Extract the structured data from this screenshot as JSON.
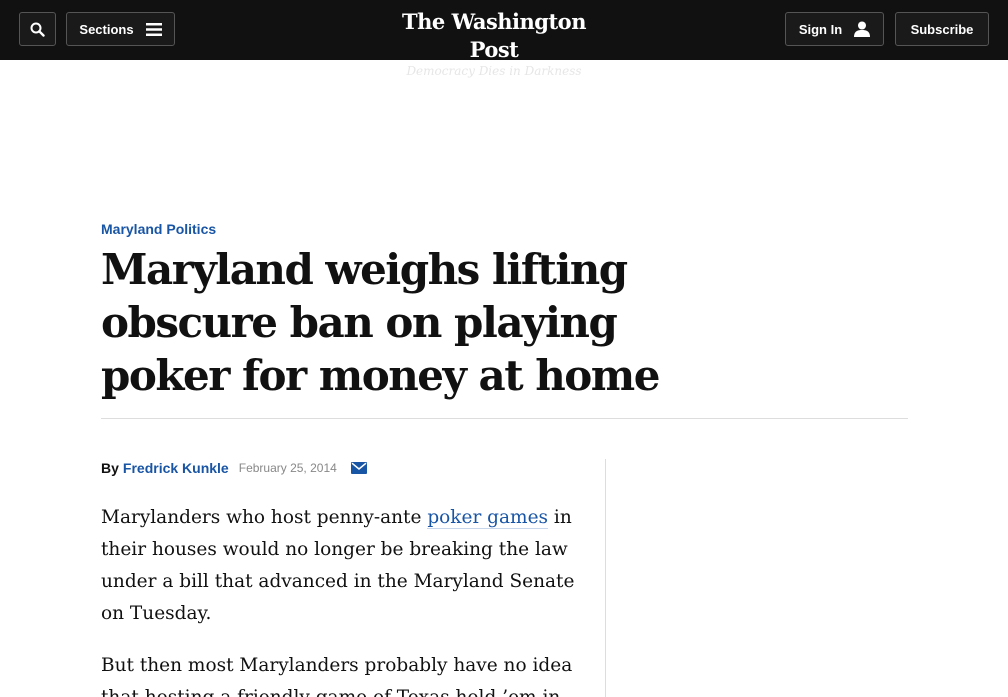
{
  "header": {
    "sections_label": "Sections",
    "logo_text": "The Washington Post",
    "tagline": "Democracy Dies in Darkness",
    "signin_label": "Sign In",
    "subscribe_label": "Subscribe"
  },
  "article": {
    "kicker": "Maryland Politics",
    "headline": "Maryland weighs lifting obscure ban on playing poker for money at home",
    "byline_prefix": "By",
    "author": "Fredrick Kunkle",
    "date": "February 25, 2014",
    "p1_before": "Marylanders who host penny-ante ",
    "p1_link": "poker games",
    "p1_after": " in their houses would no longer be breaking the law under a bill that advanced in the Maryland Senate on Tuesday.",
    "p2": "But then most Marylanders probably have no idea that hosting a friendly game of Texas hold ’em in"
  },
  "icons": {
    "search": "search-icon",
    "menu": "hamburger-menu-icon",
    "user": "user-icon",
    "mail": "envelope-icon"
  },
  "colors": {
    "topbar": "#111111",
    "link": "#1955a5"
  }
}
